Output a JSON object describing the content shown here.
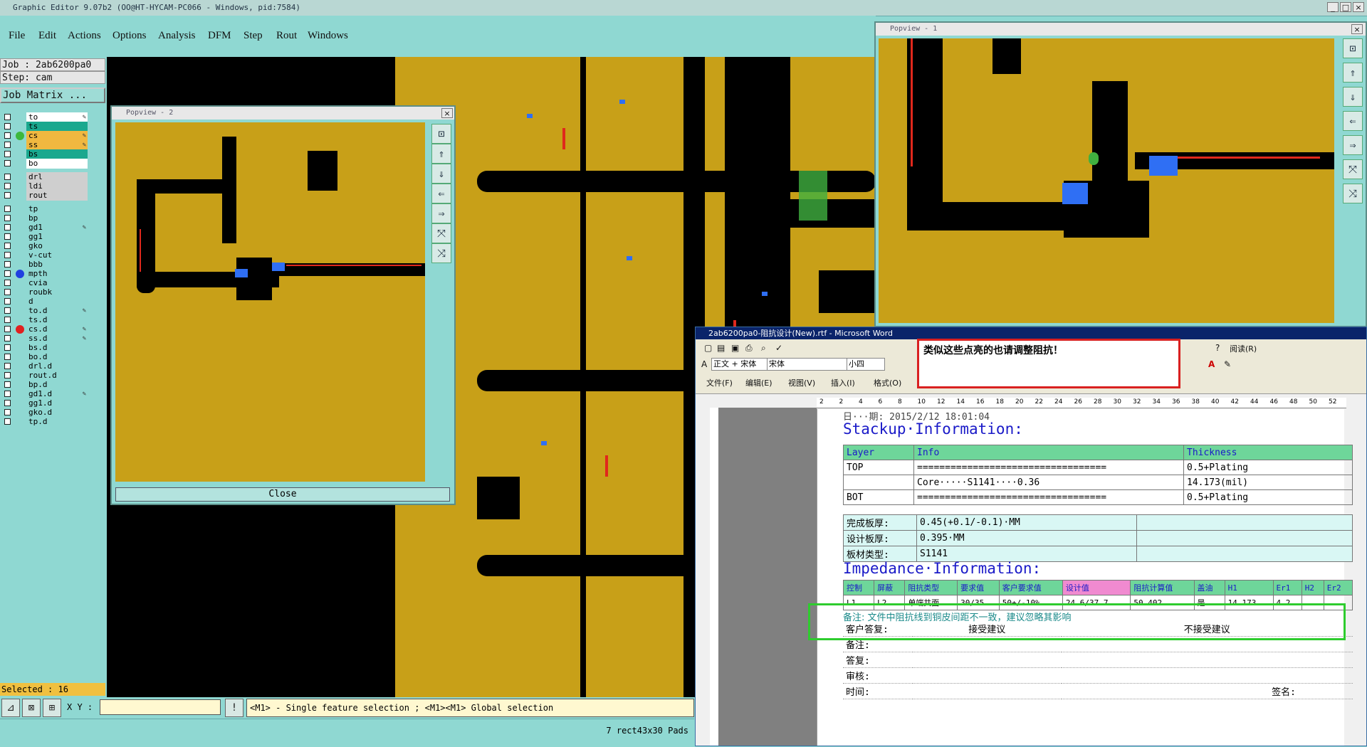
{
  "app": {
    "title": "Graphic Editor 9.07b2 (OO@HT-HYCAM-PC066 - Windows, pid:7584)",
    "menus": [
      "File",
      "Edit",
      "Actions",
      "Options",
      "Analysis",
      "DFM",
      "Step",
      "Rout",
      "Windows"
    ]
  },
  "left_panel": {
    "job": "Job : 2ab6200pa0",
    "step": "Step: cam",
    "matrix_button": "Job Matrix ...",
    "layers": [
      {
        "name": "to",
        "bg": "#ffffff",
        "marker": "",
        "edit": true
      },
      {
        "name": "ts",
        "bg": "#1aa88e",
        "marker": "",
        "edit": false
      },
      {
        "name": "cs",
        "bg": "#f0b840",
        "marker": "#3cb83c",
        "edit": true
      },
      {
        "name": "ss",
        "bg": "#f0b840",
        "marker": "",
        "edit": true
      },
      {
        "name": "bs",
        "bg": "#1aa88e",
        "marker": "",
        "edit": false
      },
      {
        "name": "bo",
        "bg": "#ffffff",
        "marker": "",
        "edit": false
      },
      {
        "name": "drl",
        "bg": "#cfcfcf",
        "marker": "",
        "edit": false
      },
      {
        "name": "ldi",
        "bg": "#cfcfcf",
        "marker": "",
        "edit": false
      },
      {
        "name": "rout",
        "bg": "#cfcfcf",
        "marker": "",
        "edit": false
      },
      {
        "name": "tp",
        "bg": "#8fd8d2",
        "marker": "",
        "edit": false
      },
      {
        "name": "bp",
        "bg": "#8fd8d2",
        "marker": "",
        "edit": false
      },
      {
        "name": "gd1",
        "bg": "#8fd8d2",
        "marker": "",
        "edit": true
      },
      {
        "name": "gg1",
        "bg": "#8fd8d2",
        "marker": "",
        "edit": false
      },
      {
        "name": "gko",
        "bg": "#8fd8d2",
        "marker": "",
        "edit": false
      },
      {
        "name": "v-cut",
        "bg": "#8fd8d2",
        "marker": "",
        "edit": false
      },
      {
        "name": "bbb",
        "bg": "#8fd8d2",
        "marker": "",
        "edit": false
      },
      {
        "name": "mpth",
        "bg": "#8fd8d2",
        "marker": "#2040e0",
        "edit": false
      },
      {
        "name": "cvia",
        "bg": "#8fd8d2",
        "marker": "",
        "edit": false
      },
      {
        "name": "roubk",
        "bg": "#8fd8d2",
        "marker": "",
        "edit": false
      },
      {
        "name": "d",
        "bg": "#8fd8d2",
        "marker": "",
        "edit": false
      },
      {
        "name": "to.d",
        "bg": "#8fd8d2",
        "marker": "",
        "edit": true
      },
      {
        "name": "ts.d",
        "bg": "#8fd8d2",
        "marker": "",
        "edit": false
      },
      {
        "name": "cs.d",
        "bg": "#8fd8d2",
        "marker": "#e02020",
        "edit": true
      },
      {
        "name": "ss.d",
        "bg": "#8fd8d2",
        "marker": "",
        "edit": true
      },
      {
        "name": "bs.d",
        "bg": "#8fd8d2",
        "marker": "",
        "edit": false
      },
      {
        "name": "bo.d",
        "bg": "#8fd8d2",
        "marker": "",
        "edit": false
      },
      {
        "name": "drl.d",
        "bg": "#8fd8d2",
        "marker": "",
        "edit": false
      },
      {
        "name": "rout.d",
        "bg": "#8fd8d2",
        "marker": "",
        "edit": false
      },
      {
        "name": "bp.d",
        "bg": "#8fd8d2",
        "marker": "",
        "edit": false
      },
      {
        "name": "gd1.d",
        "bg": "#8fd8d2",
        "marker": "",
        "edit": true
      },
      {
        "name": "gg1.d",
        "bg": "#8fd8d2",
        "marker": "",
        "edit": false
      },
      {
        "name": "gko.d",
        "bg": "#8fd8d2",
        "marker": "",
        "edit": false
      },
      {
        "name": "tp.d",
        "bg": "#8fd8d2",
        "marker": "",
        "edit": false
      }
    ],
    "selected": "Selected : 16"
  },
  "bottom": {
    "xy_label": "X Y :",
    "xy_value": "",
    "hint": "<M1> - Single feature selection ; <M1><M1> Global selection",
    "status": "7 rect43x30 Pads"
  },
  "popview2": {
    "title": "Popview - 2",
    "close_label": "Close"
  },
  "popview1": {
    "title": "Popview - 1"
  },
  "callout": {
    "text": "类似这些点亮的也请调整阻抗！"
  },
  "word": {
    "title": "2ab6200pa0-阻抗设计(New).rtf - Microsoft Word",
    "style_box": "正文 + 宋体",
    "font_box": "宋体",
    "size_box": "小四",
    "read_button": "阅读(R)",
    "menus": [
      "文件(F)",
      "编辑(E)",
      "视图(V)",
      "插入(I)",
      "格式(O)"
    ],
    "ruler_ticks": [
      "2",
      "2",
      "4",
      "6",
      "8",
      "10",
      "12",
      "14",
      "16",
      "18",
      "20",
      "22",
      "24",
      "26",
      "28",
      "30",
      "32",
      "34",
      "36",
      "38",
      "40",
      "42",
      "44",
      "46",
      "48",
      "50",
      "52"
    ],
    "date_line": "日···期: 2015/2/12 18:01:04",
    "stackup_heading": "Stackup·Information:",
    "stackup_headers": [
      "Layer",
      "Info",
      "Thickness"
    ],
    "stackup_rows": [
      [
        "TOP",
        "==================================",
        "0.5+Plating"
      ],
      [
        "",
        "Core·····S1141····0.36",
        "14.173(mil)"
      ],
      [
        "BOT",
        "==================================",
        "0.5+Plating"
      ]
    ],
    "board_rows": [
      [
        "完成板厚:",
        "0.45(+0.1/-0.1)·MM",
        ""
      ],
      [
        "设计板厚:",
        "0.395·MM",
        ""
      ],
      [
        "板材类型:",
        "S1141",
        ""
      ]
    ],
    "impedance_heading": "Impedance·Information:",
    "imp_headers": [
      "控制",
      "屏蔽",
      "阻抗类型",
      "要求值",
      "客户要求值",
      "设计值",
      "阻抗计算值",
      "盖油",
      "H1",
      "Er1",
      "H2",
      "Er2"
    ],
    "imp_row": [
      "L1",
      "L2",
      "单端共面",
      "30/35",
      "50+/-10%",
      "24.6/37.7",
      "50.402",
      "是",
      "14.173",
      "4.2",
      "",
      ""
    ],
    "note_line": "备注: 文件中阻抗线到铜皮间距不一致，建议忽略其影响",
    "reply_rows": [
      [
        "客户答复:",
        "接受建议",
        "不接受建议"
      ],
      [
        "备注:",
        "",
        ""
      ],
      [
        "答复:",
        "",
        ""
      ],
      [
        "审核:",
        "",
        ""
      ],
      [
        "时间:",
        "",
        "签名:"
      ]
    ]
  }
}
